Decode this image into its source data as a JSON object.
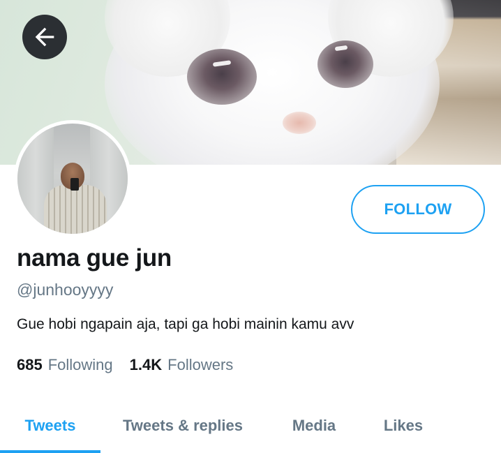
{
  "header": {
    "back_icon": "arrow-left-icon"
  },
  "profile": {
    "display_name": "nama gue jun",
    "handle": "@junhooyyyy",
    "bio": "Gue hobi ngapain aja, tapi ga hobi mainin kamu avv",
    "follow_label": "FOLLOW",
    "following_count": "685",
    "following_label": "Following",
    "followers_count": "1.4K",
    "followers_label": "Followers"
  },
  "tabs": [
    {
      "label": "Tweets",
      "active": true
    },
    {
      "label": "Tweets & replies",
      "active": false
    },
    {
      "label": "Media",
      "active": false
    },
    {
      "label": "Likes",
      "active": false
    }
  ],
  "colors": {
    "accent": "#1da1f2",
    "text_primary": "#14171a",
    "text_secondary": "#657786"
  }
}
